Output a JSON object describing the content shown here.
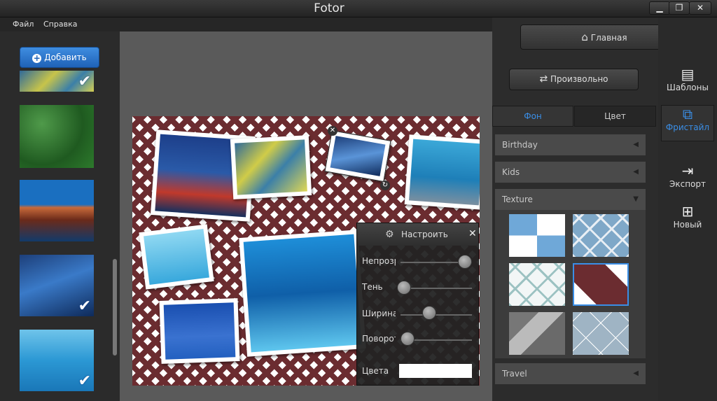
{
  "window": {
    "title": "Fotor",
    "minimize": "▁",
    "maximize": "❐",
    "close": "✕"
  },
  "menu": {
    "file": "Файл",
    "help": "Справка"
  },
  "left": {
    "add_label": "Добавить"
  },
  "adjust": {
    "title": "Настроить",
    "opacity_label": "Непрозр",
    "shadow_label": "Тень",
    "width_label": "Ширина",
    "rotate_label": "Поворот",
    "colors_label": "Цвета",
    "opacity_level": 0.9,
    "shadow_level": 0.05,
    "width_level": 0.4,
    "rotate_level": 0.1
  },
  "right": {
    "home_label": "Главная",
    "random_label": "Произвольно",
    "tab_background": "Фон",
    "tab_color": "Цвет",
    "categories": {
      "birthday": "Birthday",
      "kids": "Kids",
      "texture": "Texture",
      "travel": "Travel"
    }
  },
  "rail": {
    "templates": "Шаблоны",
    "freestyle": "Фристайл",
    "export": "Экспорт",
    "new": "Новый"
  },
  "colors": {
    "accent": "#3a8ee6",
    "collage_bg": "#6b2c30"
  }
}
